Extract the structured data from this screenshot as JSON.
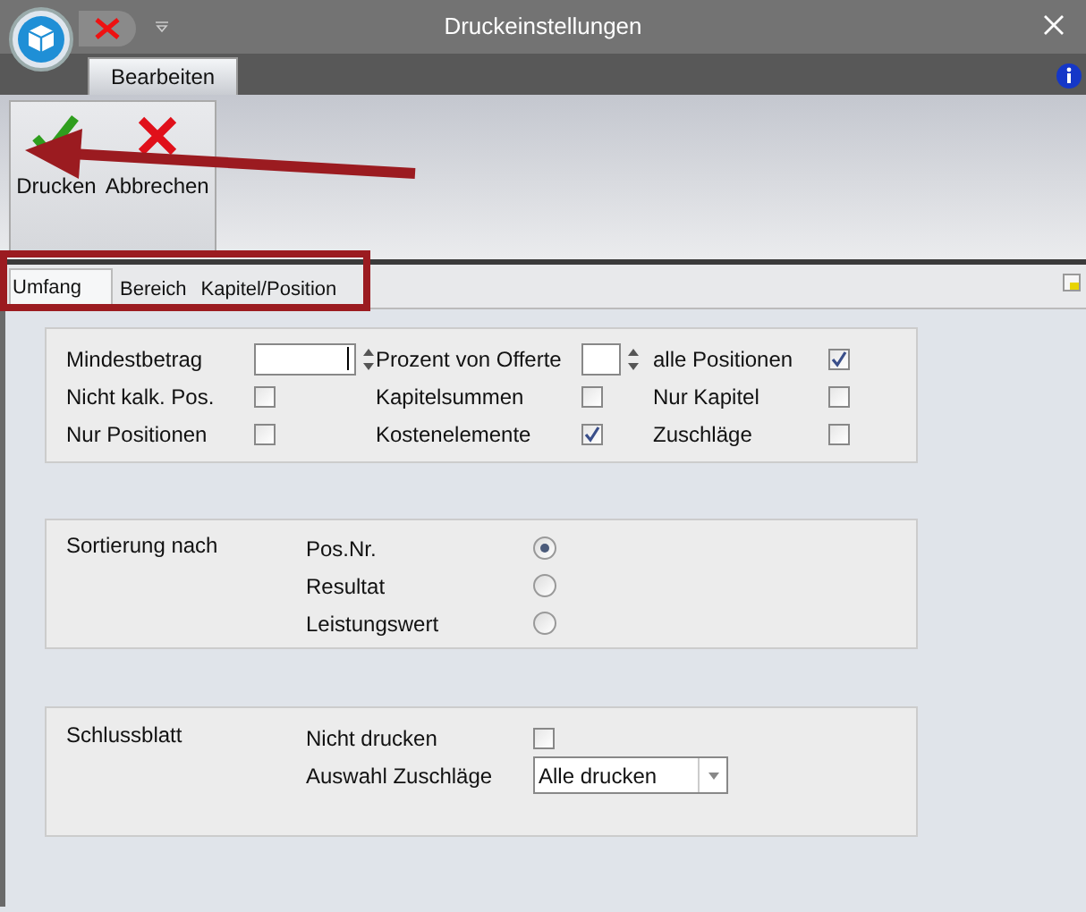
{
  "window": {
    "title": "Druckeinstellungen"
  },
  "ribbon": {
    "tabs": [
      {
        "label": "Bearbeiten",
        "selected": true
      }
    ],
    "buttons": [
      {
        "label": "Drucken",
        "kind": "ok"
      },
      {
        "label": "Abbrechen",
        "kind": "cancel"
      }
    ]
  },
  "tabs": [
    {
      "label": "Umfang",
      "selected": true
    },
    {
      "label": "Bereich",
      "selected": false
    },
    {
      "label": "Kapitel/Position",
      "selected": false
    }
  ],
  "umfang": {
    "rows": [
      [
        {
          "kind": "spin",
          "label": "Mindestbetrag"
        },
        {
          "kind": "spin",
          "label": "Prozent von Offerte"
        },
        {
          "kind": "check",
          "label": "alle Positionen",
          "checked": true
        }
      ],
      [
        {
          "kind": "check",
          "label": "Nicht kalk. Pos.",
          "checked": false
        },
        {
          "kind": "check",
          "label": "Kapitelsummen",
          "checked": false
        },
        {
          "kind": "check",
          "label": "Nur Kapitel",
          "checked": false
        }
      ],
      [
        {
          "kind": "check",
          "label": "Nur Positionen",
          "checked": false
        },
        {
          "kind": "check",
          "label": "Kostenelemente",
          "checked": true
        },
        {
          "kind": "check",
          "label": "Zuschläge",
          "checked": false
        }
      ]
    ]
  },
  "sortierung": {
    "label": "Sortierung nach",
    "options": [
      {
        "label": "Pos.Nr.",
        "selected": true
      },
      {
        "label": "Resultat",
        "selected": false
      },
      {
        "label": "Leistungswert",
        "selected": false
      }
    ]
  },
  "schlussblatt": {
    "label": "Schlussblatt",
    "items": [
      {
        "kind": "check",
        "label": "Nicht drucken",
        "checked": false
      },
      {
        "kind": "select",
        "label": "Auswahl Zuschläge",
        "value": "Alle drucken"
      }
    ]
  }
}
